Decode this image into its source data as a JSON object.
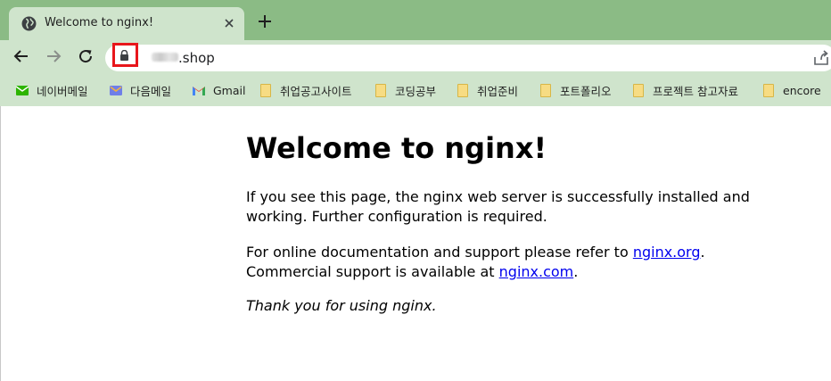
{
  "browser": {
    "tab": {
      "title": "Welcome to nginx!"
    },
    "address": {
      "domain_suffix": ".shop"
    },
    "bookmarks": [
      {
        "label": "네이버메일",
        "icon": "naver-mail-icon"
      },
      {
        "label": "다음메일",
        "icon": "daum-mail-icon"
      },
      {
        "label": "Gmail",
        "icon": "gmail-icon"
      },
      {
        "label": "취업공고사이트",
        "icon": "folder-icon"
      },
      {
        "label": "코딩공부",
        "icon": "folder-icon"
      },
      {
        "label": "취업준비",
        "icon": "folder-icon"
      },
      {
        "label": "포트폴리오",
        "icon": "folder-icon"
      },
      {
        "label": "프로젝트 참고자료",
        "icon": "folder-icon"
      },
      {
        "label": "encore",
        "icon": "folder-icon"
      }
    ],
    "colors": {
      "tabstrip": "#8bbb85",
      "toolbar": "#cfe4cc",
      "highlight": "#e8161b",
      "link": "#0000ee"
    }
  },
  "page": {
    "heading": "Welcome to nginx!",
    "p1_line1": "If you see this page, the nginx web server is successfully installed and",
    "p1_line2": "working. Further configuration is required.",
    "p2_line1_text": "For online documentation and support please refer to ",
    "p2_link1": "nginx.org",
    "p2_line1_end": ".",
    "p2_line2_text": "Commercial support is available at ",
    "p2_link2": "nginx.com",
    "p2_line2_end": ".",
    "thanks": "Thank you for using nginx."
  }
}
